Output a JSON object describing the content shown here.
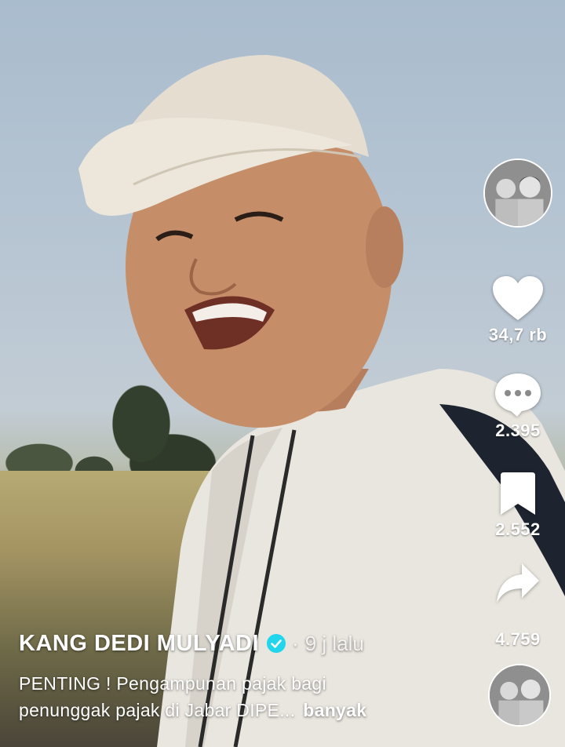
{
  "video": {
    "author": "KANG DEDI MULYADI",
    "time_separator": "·",
    "time": "9 j lalu",
    "description_line1": "PENTING ! Pengampunan pajak bagi",
    "description_line2": "penunggak pajak di Jabar DIPE...",
    "more_label": "banyak"
  },
  "actions": {
    "likes": "34,7 rb",
    "comments": "2.395",
    "saves": "2.552",
    "shares": "4.759"
  },
  "icons": {
    "like": "heart-icon",
    "comment": "comment-bubble-icon",
    "save": "bookmark-icon",
    "share": "share-arrow-icon",
    "verified": "verified-badge-icon"
  },
  "colors": {
    "verified": "#20d5ec",
    "text": "#ffffff"
  }
}
